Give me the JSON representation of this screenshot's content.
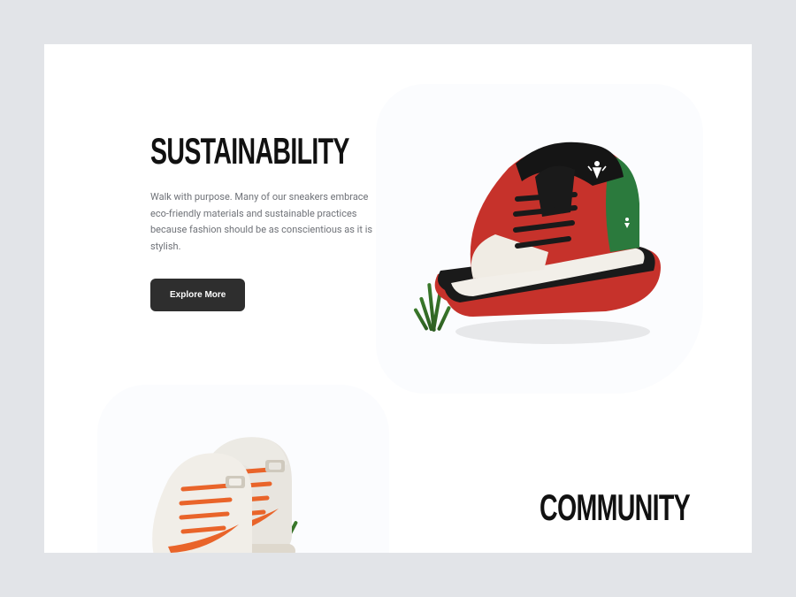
{
  "section1": {
    "heading": "SUSTAINABILITY",
    "body": "Walk with purpose. Many of our sneakers embrace eco-friendly materials and sustainable practices because fashion should be as conscientious as it is stylish.",
    "cta_label": "Explore More",
    "hero_image": "red-green-basketball-sneaker",
    "grass_icon": "grass-tuft"
  },
  "section2": {
    "heading": "COMMUNITY",
    "hero_image": "white-orange-high-top-sneakers",
    "grass_icon": "grass-tuft"
  },
  "colors": {
    "page_bg": "#e2e4e8",
    "card_bg": "#fbfcfe",
    "text_muted": "#6e7177",
    "button_bg": "#2e2e2e",
    "shoe1_primary": "#c6322b",
    "shoe1_accent": "#2b7a3d",
    "shoe2_primary": "#e8e5df",
    "shoe2_accent": "#e9642a",
    "grass": "#3a7a2b"
  }
}
